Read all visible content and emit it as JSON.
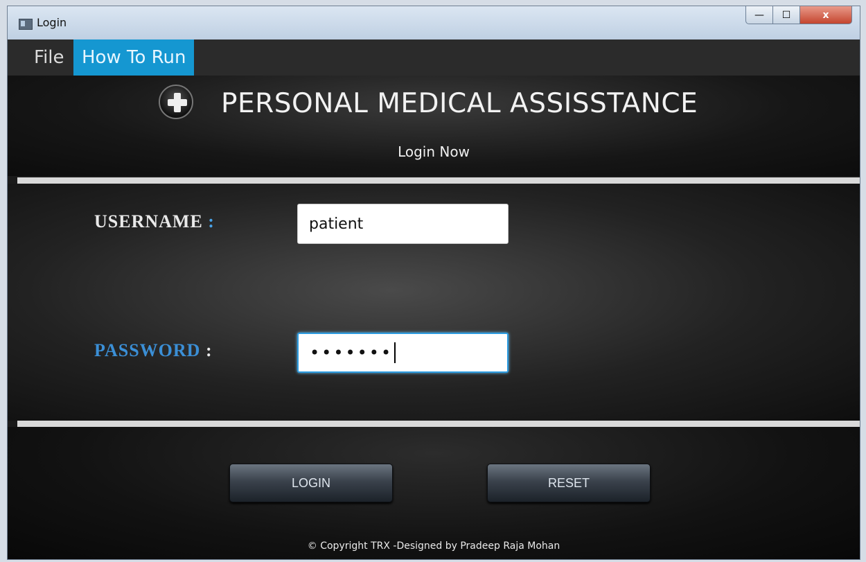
{
  "window": {
    "title": "Login",
    "close_glyph": "x",
    "min_glyph": "—",
    "max_glyph": "☐"
  },
  "menu": {
    "items": [
      {
        "label": "File"
      },
      {
        "label": "How To Run"
      }
    ]
  },
  "header": {
    "title": "PERSONAL MEDICAL ASSISSTANCE",
    "subtitle": "Login Now",
    "logo_icon": "medical-cross-icon"
  },
  "form": {
    "username_label": "USERNAME",
    "username_colon": ":",
    "username_value": "patient",
    "password_label": "PASSWORD",
    "password_colon": ":",
    "password_masked": "•••••••"
  },
  "buttons": {
    "login": "LOGIN",
    "reset": "RESET"
  },
  "footer": {
    "copyright": "© Copyright TRX -Designed by Pradeep Raja Mohan"
  },
  "colors": {
    "menu_active": "#1597d1",
    "accent_blue": "#3b8fd6",
    "background": "#1a1a1a"
  }
}
